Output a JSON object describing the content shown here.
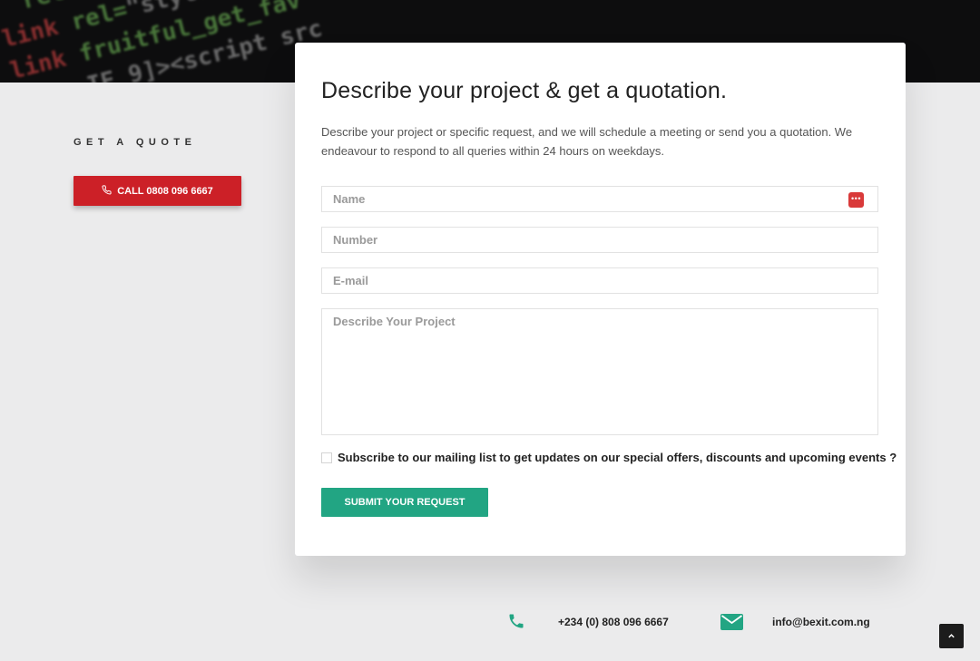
{
  "colors": {
    "accent_red": "#cc2027",
    "accent_green": "#22a583",
    "background": "#ebebec",
    "hero_dark": "#0d0d0e"
  },
  "sidebar": {
    "heading": "GET A QUOTE",
    "call_button_label": "CALL 0808 096 6667",
    "call_icon": "phone-icon"
  },
  "form": {
    "title": "Describe your project & get a quotation.",
    "description": "Describe your project or specific request, and we will schedule a meeting or send you a quotation. We endeavour to respond to all queries within 24 hours on weekdays.",
    "fields": {
      "name_placeholder": "Name",
      "number_placeholder": "Number",
      "email_placeholder": "E-mail",
      "project_placeholder": "Describe Your Project"
    },
    "password_manager_icon": "ellipsis-key-icon",
    "subscribe_label": "Subscribe to our mailing list to get updates on our special offers, discounts and upcoming events ?",
    "subscribe_checked": false,
    "submit_label": "SUBMIT YOUR REQUEST"
  },
  "contact": {
    "phone_icon": "phone-icon",
    "phone": "+234 (0) 808 096 6667",
    "email_icon": "envelope-icon",
    "email": "info@bexit.com.ng"
  },
  "scroll_top_icon": "chevron-up-icon"
}
